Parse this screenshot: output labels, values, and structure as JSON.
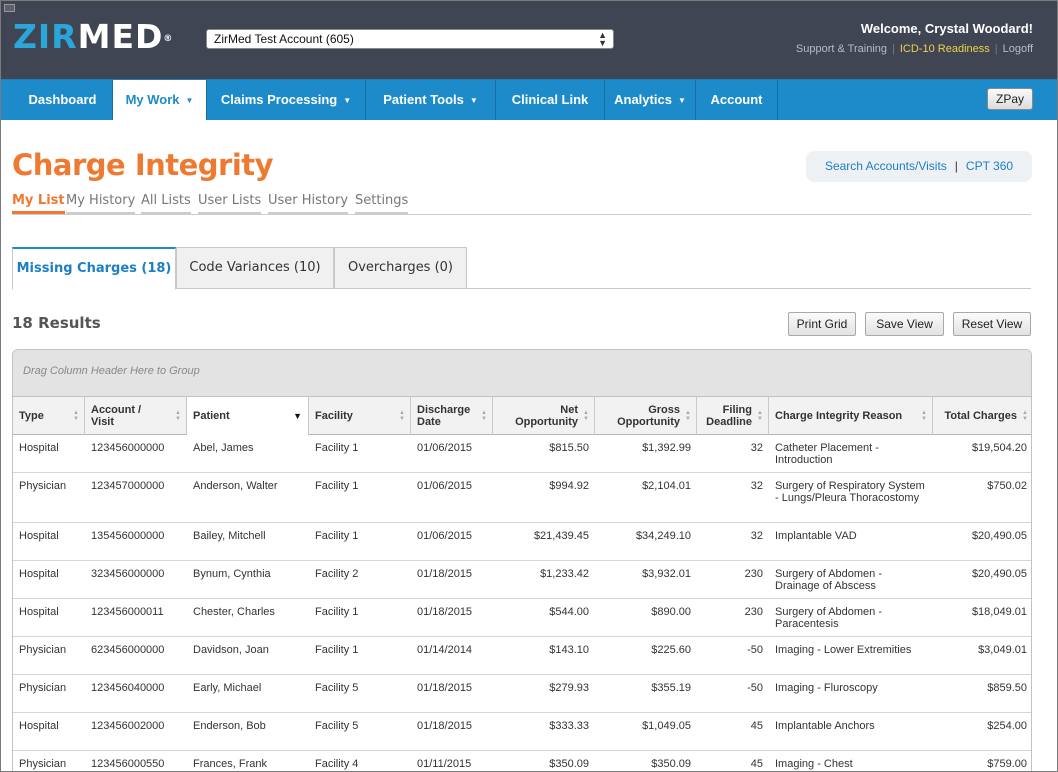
{
  "header": {
    "logo_zi": "ZIR",
    "logo_med": "MED",
    "logo_mark": "®",
    "account_selector": "ZirMed Test Account (605)",
    "welcome": "Welcome, Crystal Woodard!",
    "links": {
      "support": "Support & Training",
      "icd10": "ICD-10 Readiness",
      "logoff": "Logoff"
    },
    "separator": "|"
  },
  "nav": {
    "items": [
      {
        "label": "Dashboard"
      },
      {
        "label": "My Work"
      },
      {
        "label": "Claims Processing"
      },
      {
        "label": "Patient Tools"
      },
      {
        "label": "Clinical Link"
      },
      {
        "label": "Analytics"
      },
      {
        "label": "Account"
      }
    ],
    "zpay": "ZPay",
    "caret": "▼"
  },
  "page": {
    "title": "Charge Integrity",
    "quicklinks": {
      "search": "Search Accounts/Visits",
      "cpt": "CPT 360",
      "sep": "|"
    },
    "subtabs": [
      "My List",
      "My History",
      "All Lists",
      "User Lists",
      "User History",
      "Settings"
    ],
    "result_tabs": [
      "Missing Charges  (18)",
      "Code Variances  (10)",
      "Overcharges  (0)"
    ],
    "results_count": "18 Results",
    "buttons": {
      "print": "Print Grid",
      "save": "Save View",
      "reset": "Reset View"
    }
  },
  "grid": {
    "group_hint": "Drag Column Header Here to Group",
    "columns": [
      {
        "label": "Type"
      },
      {
        "label": "Account / Visit"
      },
      {
        "label": "Patient"
      },
      {
        "label": "Facility"
      },
      {
        "label": "Discharge Date"
      },
      {
        "label": "Net Opportunity"
      },
      {
        "label": "Gross Opportunity"
      },
      {
        "label": "Filing Deadline"
      },
      {
        "label": "Charge Integrity Reason"
      },
      {
        "label": "Total Charges"
      }
    ],
    "rows": [
      [
        "Hospital",
        "123456000000",
        "Abel, James",
        "Facility 1",
        "01/06/2015",
        "$815.50",
        "$1,392.99",
        "32",
        "Catheter Placement - Introduction",
        "$19,504.20"
      ],
      [
        "Physician",
        "123457000000",
        "Anderson, Walter",
        "Facility 1",
        "01/06/2015",
        "$994.92",
        "$2,104.01",
        "32",
        "Surgery of Respiratory System - Lungs/Pleura Thoracostomy",
        "$750.02"
      ],
      [
        "Hospital",
        "135456000000",
        "Bailey, Mitchell",
        "Facility 1",
        "01/06/2015",
        "$21,439.45",
        "$34,249.10",
        "32",
        "Implantable VAD",
        "$20,490.05"
      ],
      [
        "Hospital",
        "323456000000",
        "Bynum, Cynthia",
        "Facility 2",
        "01/18/2015",
        "$1,233.42",
        "$3,932.01",
        "230",
        "Surgery of Abdomen - Drainage of Abscess",
        "$20,490.05"
      ],
      [
        "Hospital",
        "123456000011",
        "Chester, Charles",
        "Facility 1",
        "01/18/2015",
        "$544.00",
        "$890.00",
        "230",
        "Surgery of Abdomen - Paracentesis",
        "$18,049.01"
      ],
      [
        "Physician",
        "623456000000",
        "Davidson, Joan",
        "Facility 1",
        "01/14/2014",
        "$143.10",
        "$225.60",
        "-50",
        "Imaging - Lower Extremities",
        "$3,049.01"
      ],
      [
        "Physician",
        "123456040000",
        "Early, Michael",
        "Facility 5",
        "01/18/2015",
        "$279.93",
        "$355.19",
        "-50",
        "Imaging - Fluroscopy",
        "$859.50"
      ],
      [
        "Hospital",
        "123456002000",
        "Enderson, Bob",
        "Facility 5",
        "01/18/2015",
        "$333.33",
        "$1,049.05",
        "45",
        "Implantable Anchors",
        "$254.00"
      ],
      [
        "Physician",
        "123456000550",
        "Frances, Frank",
        "Facility 4",
        "01/11/2015",
        "$350.09",
        "$350.09",
        "45",
        "Imaging - Chest",
        "$759.00"
      ]
    ]
  }
}
